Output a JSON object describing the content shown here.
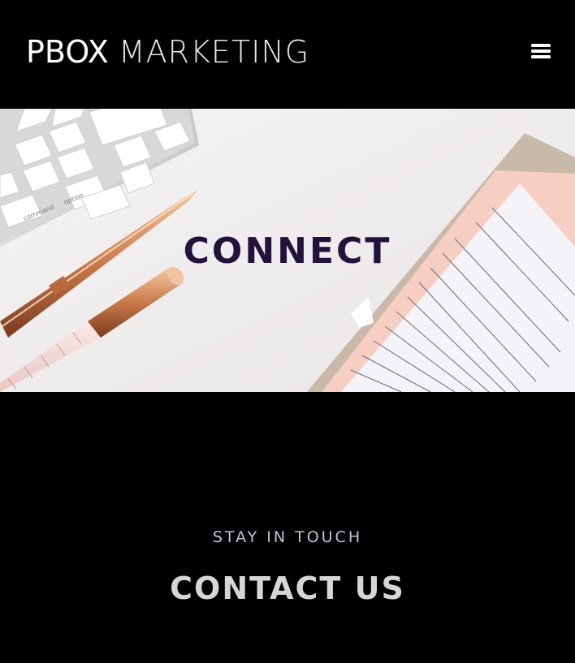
{
  "header": {
    "logo_primary": "PBOX",
    "logo_secondary": "MARKETING",
    "menu_icon": "hamburger-menu-icon"
  },
  "hero": {
    "title": "CONNECT",
    "keyboard_keys": [
      "command",
      "option"
    ]
  },
  "contact": {
    "eyebrow": "STAY IN TOUCH",
    "heading": "CONTACT US"
  },
  "colors": {
    "background": "#000000",
    "hero_title": "#24123d",
    "eyebrow": "#c8bfd6",
    "heading": "#d6d6d6",
    "logo": "#ffffff"
  }
}
